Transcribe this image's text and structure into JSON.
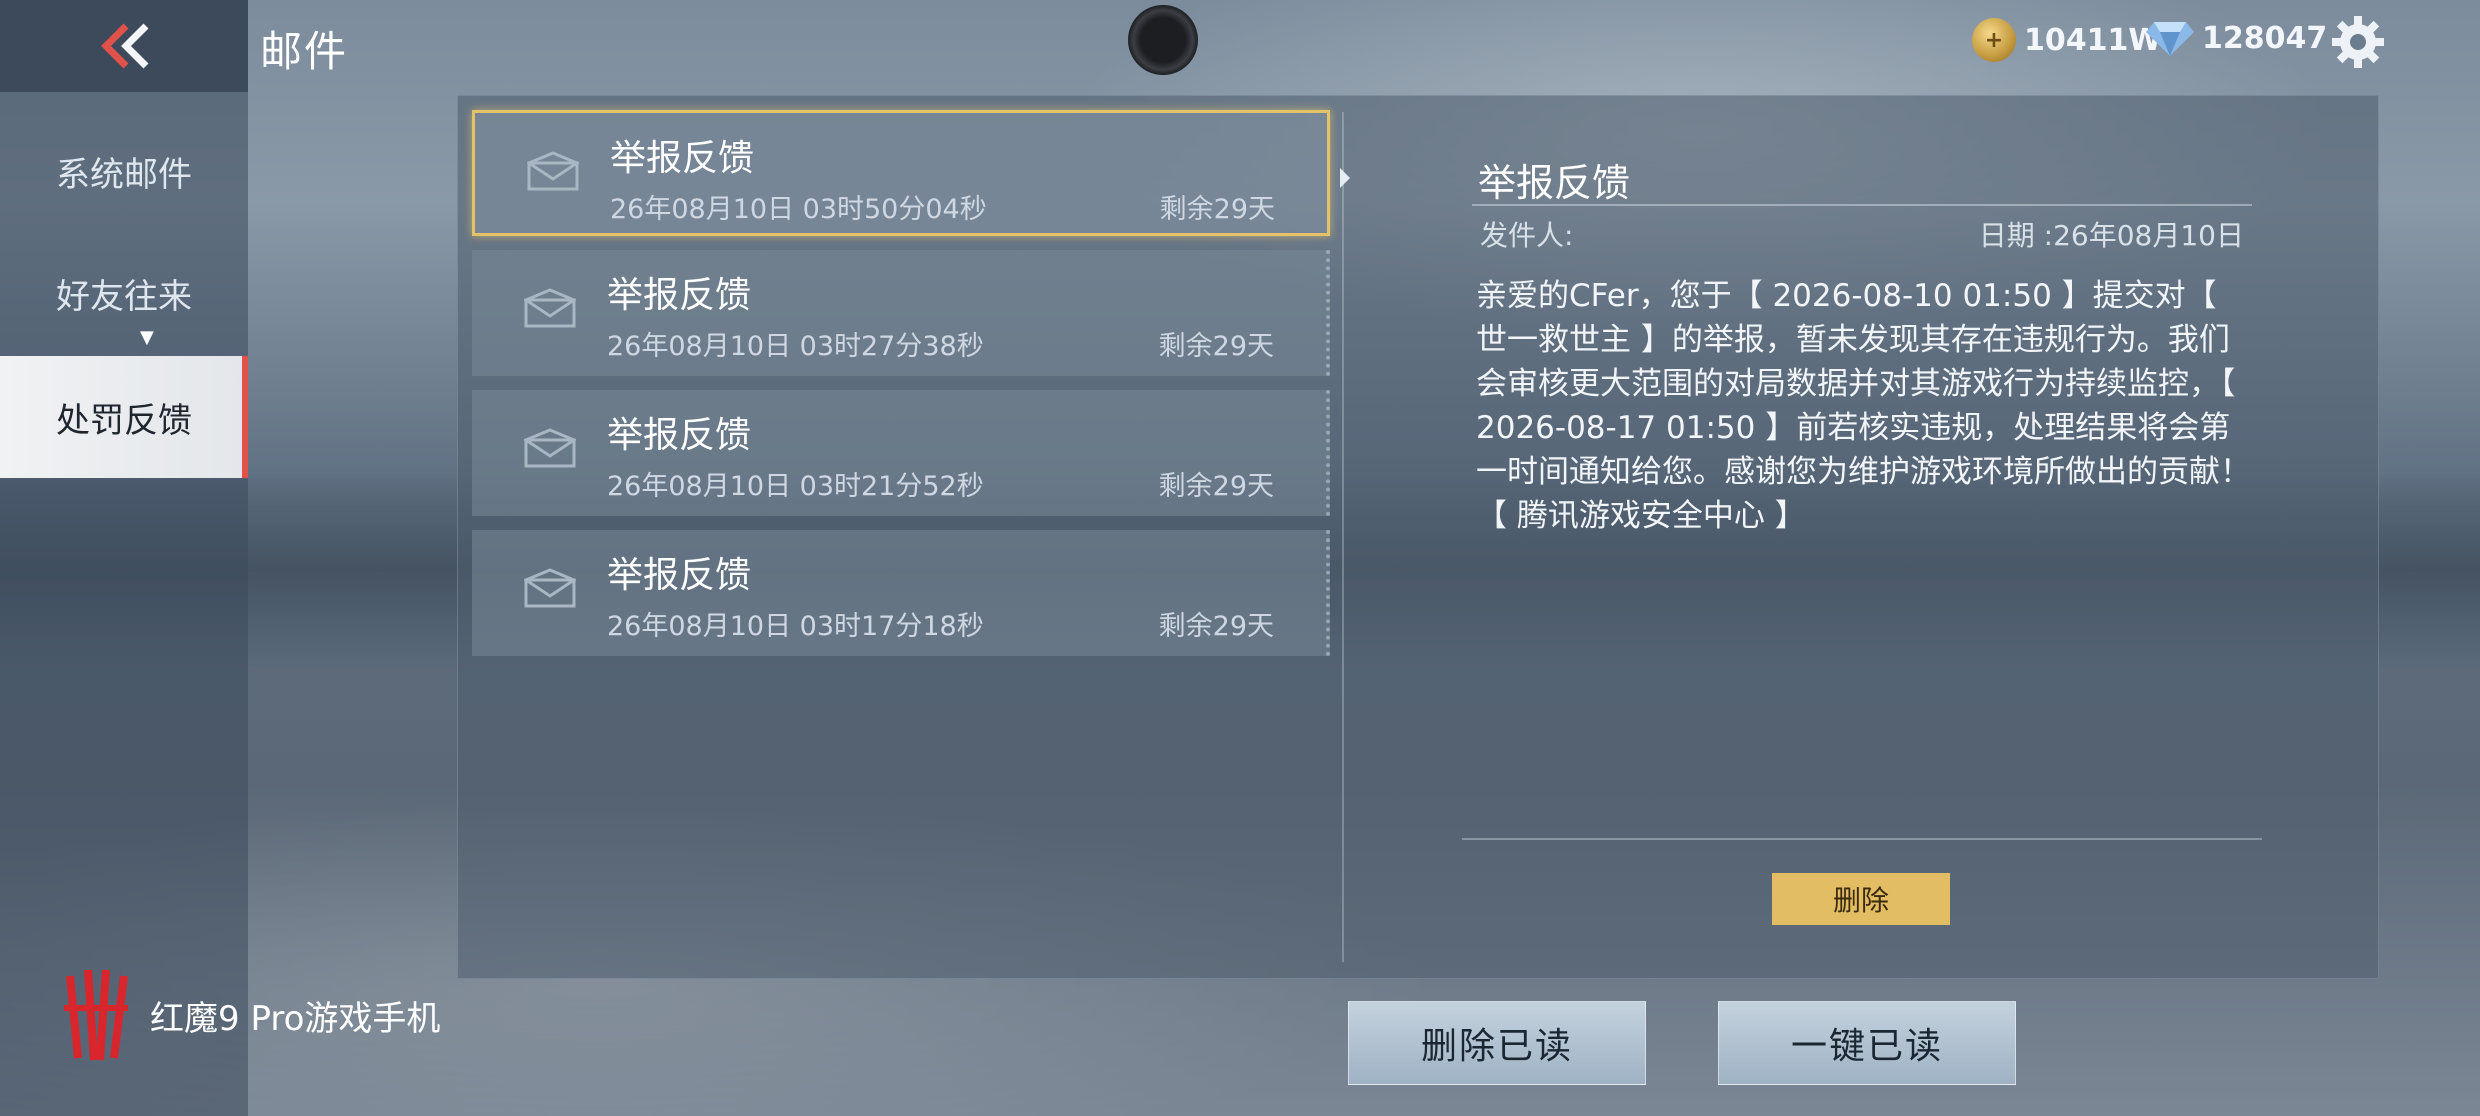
{
  "header": {
    "title": "邮件",
    "gold_amount": "10411W",
    "diamond_amount": "128047"
  },
  "sidebar": {
    "items": [
      {
        "label": "系统邮件"
      },
      {
        "label": "好友往来"
      },
      {
        "label": "处罚反馈"
      }
    ]
  },
  "mails": [
    {
      "title": "举报反馈",
      "date": "26年08月10日 03时50分04秒",
      "remain": "剩余29天"
    },
    {
      "title": "举报反馈",
      "date": "26年08月10日 03时27分38秒",
      "remain": "剩余29天"
    },
    {
      "title": "举报反馈",
      "date": "26年08月10日 03时21分52秒",
      "remain": "剩余29天"
    },
    {
      "title": "举报反馈",
      "date": "26年08月10日 03时17分18秒",
      "remain": "剩余29天"
    }
  ],
  "detail": {
    "title": "举报反馈",
    "sender_label": "发件人:",
    "date_label": "日期 :26年08月10日",
    "body": "亲爱的CFer，您于【 2026-08-10 01:50 】提交对【 世一救世主 】的举报，暂未发现其存在违规行为。我们会审核更大范围的对局数据并对其游戏行为持续监控，【 2026-08-17 01:50 】前若核实违规，处理结果将会第一时间通知给您。感谢您为维护游戏环境所做出的贡献！【 腾讯游戏安全中心 】",
    "delete_label": "删除"
  },
  "actions": {
    "delete_read": "删除已读",
    "mark_all_read": "一键已读"
  },
  "watermark": {
    "text": "红魔9 Pro游戏手机"
  },
  "colors": {
    "accent_gold": "#e2bd63",
    "active_red": "#e0524a"
  }
}
